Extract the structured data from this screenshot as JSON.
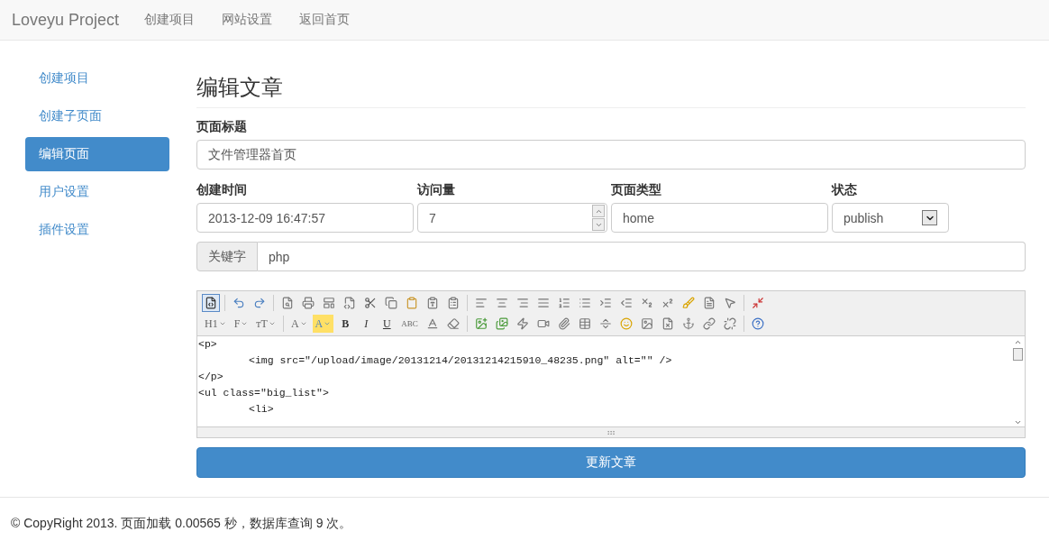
{
  "navbar": {
    "brand": "Loveyu Project",
    "links": [
      {
        "label": "创建项目"
      },
      {
        "label": "网站设置"
      },
      {
        "label": "返回首页"
      }
    ]
  },
  "sidebar": {
    "items": [
      {
        "label": "创建项目",
        "selected": false
      },
      {
        "label": "创建子页面",
        "selected": false
      },
      {
        "label": "编辑页面",
        "selected": true
      },
      {
        "label": "用户设置",
        "selected": false
      },
      {
        "label": "插件设置",
        "selected": false
      }
    ]
  },
  "heading": "编辑文章",
  "title_field": {
    "label": "页面标题",
    "value": "文件管理器首页"
  },
  "meta_fields": [
    {
      "kind": "text",
      "label": "创建时间",
      "value": "2013-12-09 16:47:57"
    },
    {
      "kind": "number",
      "label": "访问量",
      "value": "7"
    },
    {
      "kind": "text",
      "label": "页面类型",
      "value": "home"
    },
    {
      "kind": "select",
      "label": "状态",
      "value": "publish"
    }
  ],
  "keyword": {
    "addon": "关键字",
    "value": "php"
  },
  "editor": {
    "source_mode": true,
    "toolbar": [
      [
        {
          "kind": "source"
        },
        {
          "kind": "sep"
        },
        {
          "kind": "undo"
        },
        {
          "kind": "redo"
        },
        {
          "kind": "sep"
        },
        {
          "kind": "preview"
        },
        {
          "kind": "print"
        },
        {
          "kind": "template"
        },
        {
          "kind": "code"
        },
        {
          "kind": "cut"
        },
        {
          "kind": "copy"
        },
        {
          "kind": "paste"
        },
        {
          "kind": "plainpaste"
        },
        {
          "kind": "wordpaste"
        },
        {
          "kind": "sep"
        },
        {
          "kind": "alignleft"
        },
        {
          "kind": "aligncenter"
        },
        {
          "kind": "alignright"
        },
        {
          "kind": "justify"
        },
        {
          "kind": "orderedlist"
        },
        {
          "kind": "unorderedlist"
        },
        {
          "kind": "indent"
        },
        {
          "kind": "outdent"
        },
        {
          "kind": "subscript"
        },
        {
          "kind": "superscript"
        },
        {
          "kind": "clearhtml"
        },
        {
          "kind": "quickformat"
        },
        {
          "kind": "selectall"
        },
        {
          "kind": "sep"
        },
        {
          "kind": "fullscreen"
        }
      ],
      [
        {
          "kind": "dropdown",
          "label": "H1"
        },
        {
          "kind": "dropdown",
          "label": "F"
        },
        {
          "kind": "dropdown",
          "label": "тT"
        },
        {
          "kind": "sep"
        },
        {
          "kind": "dropdown",
          "label": "A"
        },
        {
          "kind": "highlight",
          "label": "A"
        },
        {
          "kind": "bold",
          "label": "B"
        },
        {
          "kind": "italic",
          "label": "I"
        },
        {
          "kind": "underline",
          "label": "U"
        },
        {
          "kind": "strike",
          "label": "ABC"
        },
        {
          "kind": "lineheight"
        },
        {
          "kind": "eraser"
        },
        {
          "kind": "sep"
        },
        {
          "kind": "image"
        },
        {
          "kind": "multiimage"
        },
        {
          "kind": "flash"
        },
        {
          "kind": "media"
        },
        {
          "kind": "attachment"
        },
        {
          "kind": "table"
        },
        {
          "kind": "hr"
        },
        {
          "kind": "emoticon"
        },
        {
          "kind": "picture"
        },
        {
          "kind": "pagebreak"
        },
        {
          "kind": "anchor"
        },
        {
          "kind": "link"
        },
        {
          "kind": "unlink"
        },
        {
          "kind": "sep"
        },
        {
          "kind": "help"
        }
      ]
    ],
    "lines": [
      {
        "code": "<p>",
        "children": [
          {
            "code": "<img src=\"/upload/image/20131214/20131214215910_48235.png\" alt=\"\" />"
          }
        ]
      },
      {
        "code": "</p>"
      },
      {
        "code": "<ul class=\"big_list\">",
        "children": [
          {
            "code": "<li>"
          }
        ]
      }
    ]
  },
  "submit": "更新文章",
  "footer": "© CopyRight 2013. 页面加载 0.00565 秒，数据库查询 9 次。"
}
